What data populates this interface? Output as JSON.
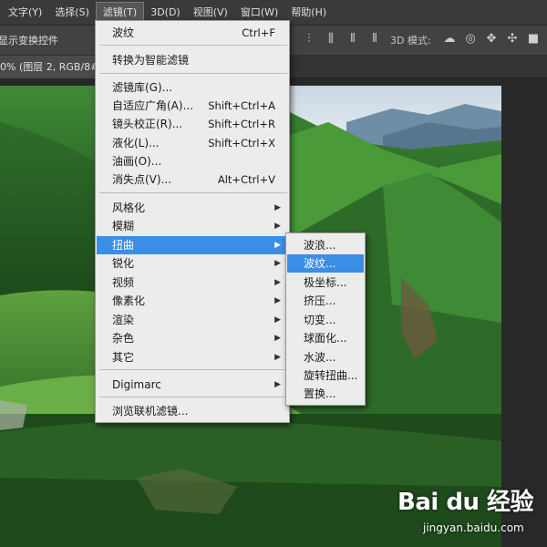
{
  "menubar": {
    "items": [
      {
        "label": "文字(Y)"
      },
      {
        "label": "选择(S)"
      },
      {
        "label": "滤镜(T)"
      },
      {
        "label": "3D(D)"
      },
      {
        "label": "视图(V)"
      },
      {
        "label": "窗口(W)"
      },
      {
        "label": "帮助(H)"
      }
    ]
  },
  "options": {
    "show_transform_controls": "显示变换控件",
    "mode3d_label": "3D 模式:"
  },
  "document": {
    "tab_label": "0% (图层 2, RGB/8#)"
  },
  "filter_menu": {
    "ripple": {
      "label": "波纹",
      "shortcut": "Ctrl+F"
    },
    "convert_smart": {
      "label": "转换为智能滤镜"
    },
    "gallery": {
      "label": "滤镜库(G)..."
    },
    "adaptive_wide": {
      "label": "自适应广角(A)...",
      "shortcut": "Shift+Ctrl+A"
    },
    "lens_correction": {
      "label": "镜头校正(R)...",
      "shortcut": "Shift+Ctrl+R"
    },
    "liquify": {
      "label": "液化(L)...",
      "shortcut": "Shift+Ctrl+X"
    },
    "oil_paint": {
      "label": "油画(O)..."
    },
    "vanishing_point": {
      "label": "消失点(V)...",
      "shortcut": "Alt+Ctrl+V"
    },
    "stylize": {
      "label": "风格化"
    },
    "blur": {
      "label": "模糊"
    },
    "distort": {
      "label": "扭曲"
    },
    "sharpen": {
      "label": "锐化"
    },
    "video": {
      "label": "视频"
    },
    "pixelate": {
      "label": "像素化"
    },
    "render": {
      "label": "渲染"
    },
    "noise": {
      "label": "杂色"
    },
    "other": {
      "label": "其它"
    },
    "digimarc": {
      "label": "Digimarc"
    },
    "browse_online": {
      "label": "浏览联机滤镜..."
    }
  },
  "distort_submenu": {
    "items": [
      {
        "label": "波浪..."
      },
      {
        "label": "波纹..."
      },
      {
        "label": "极坐标..."
      },
      {
        "label": "挤压..."
      },
      {
        "label": "切变..."
      },
      {
        "label": "球面化..."
      },
      {
        "label": "水波..."
      },
      {
        "label": "旋转扭曲..."
      },
      {
        "label": "置换..."
      }
    ]
  },
  "watermark": {
    "logo_text": "Bai du 经验",
    "url": "jingyan.baidu.com"
  },
  "colors": {
    "menu_highlight": "#3a8ee6",
    "menubar_bg": "#3a3a3a",
    "menu_bg": "#ececec"
  }
}
